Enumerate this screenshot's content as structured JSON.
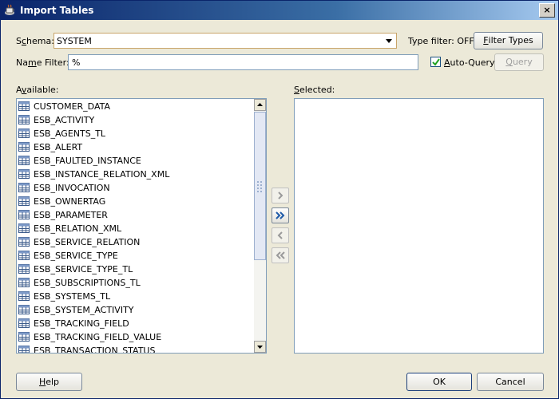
{
  "window": {
    "title": "Import Tables",
    "close_label": "×"
  },
  "schema": {
    "label_prefix": "S",
    "label_ul": "c",
    "label_suffix": "hema:",
    "value": "SYSTEM"
  },
  "type_filter": {
    "text": "Type filter: OFF"
  },
  "filter_types_button": {
    "ul": "F",
    "rest": "ilter Types"
  },
  "name_filter": {
    "label_prefix": "Na",
    "label_ul": "m",
    "label_suffix": "e Filter:",
    "value": "%"
  },
  "auto_query": {
    "ul": "A",
    "rest": "uto-Query",
    "checked": true
  },
  "query_button": {
    "ul": "Q",
    "rest": "uery",
    "enabled": false
  },
  "available": {
    "label_prefix": "A",
    "label_ul": "v",
    "label_suffix": "ailable:",
    "items": [
      "CUSTOMER_DATA",
      "ESB_ACTIVITY",
      "ESB_AGENTS_TL",
      "ESB_ALERT",
      "ESB_FAULTED_INSTANCE",
      "ESB_INSTANCE_RELATION_XML",
      "ESB_INVOCATION",
      "ESB_OWNERTAG",
      "ESB_PARAMETER",
      "ESB_RELATION_XML",
      "ESB_SERVICE_RELATION",
      "ESB_SERVICE_TYPE",
      "ESB_SERVICE_TYPE_TL",
      "ESB_SUBSCRIPTIONS_TL",
      "ESB_SYSTEMS_TL",
      "ESB_SYSTEM_ACTIVITY",
      "ESB_TRACKING_FIELD",
      "ESB_TRACKING_FIELD_VALUE",
      "ESB_TRANSACTION_STATUS"
    ]
  },
  "selected": {
    "label_ul": "S",
    "label_suffix": "elected:",
    "items": []
  },
  "buttons": {
    "help": {
      "ul": "H",
      "rest": "elp"
    },
    "ok": "OK",
    "cancel": "Cancel"
  },
  "colors": {
    "title_start": "#0a246a",
    "title_end": "#a6caf0",
    "accent": "#3a6ea5",
    "dialog_bg": "#ece9d8"
  }
}
